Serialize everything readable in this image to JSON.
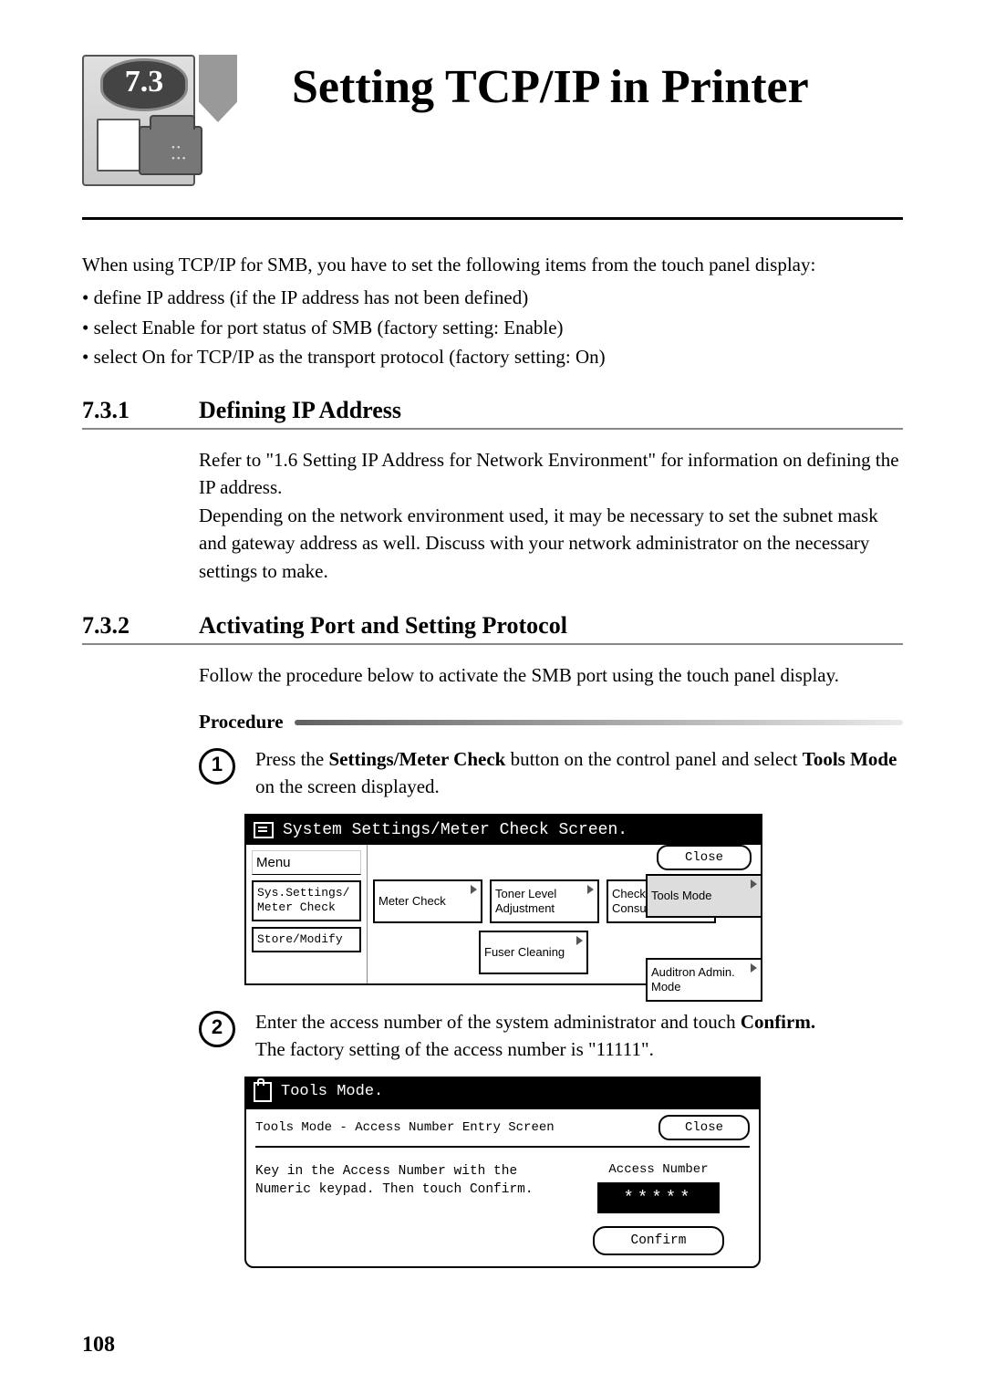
{
  "chapter": {
    "number": "7.3",
    "title": "Setting TCP/IP in Printer"
  },
  "intro": "When using TCP/IP for SMB, you have to set the following items from the touch panel display:",
  "bullets": [
    "• define IP address (if the IP address has not been defined)",
    "• select Enable for port status of SMB (factory setting: Enable)",
    "• select On for TCP/IP as the transport protocol (factory setting: On)"
  ],
  "sections": {
    "s731": {
      "num": "7.3.1",
      "title": "Defining IP Address",
      "body": "Refer to \"1.6 Setting IP Address for Network Environment\" for information on defining the IP address.\nDepending on the network environment used, it may be necessary to set the subnet mask and gateway address as well. Discuss with your network administrator on the necessary settings to make."
    },
    "s732": {
      "num": "7.3.2",
      "title": "Activating Port and Setting Protocol",
      "lead": "Follow the procedure below to activate the SMB port using the touch panel display.",
      "procedure_label": "Procedure",
      "steps": {
        "1": {
          "pre": "Press the ",
          "bold1": "Settings/Meter Check",
          "mid": " button on the control panel and select ",
          "bold2": "Tools Mode",
          "post": " on the screen displayed."
        },
        "2": {
          "pre": "Enter the access number of the system administrator and touch ",
          "bold1": "Confirm.",
          "post2": "The factory setting of the access number is \"11111\"."
        }
      }
    }
  },
  "panel1": {
    "title": "System Settings/Meter Check Screen.",
    "menu_label": "Menu",
    "close": "Close",
    "sys_settings": "Sys.Settings/\nMeter Check",
    "store_modify": "Store/Modify",
    "meter_check": "Meter Check",
    "toner": "Toner Level Adjustment",
    "check_consumables": "Check Consumables",
    "fuser": "Fuser Cleaning",
    "tools_mode": "Tools Mode",
    "auditron": "Auditron Admin. Mode"
  },
  "panel2": {
    "title": "Tools Mode.",
    "tab_label": "Tools Mode - Access Number Entry Screen",
    "close": "Close",
    "instruction": "Key in the Access Number with the Numeric keypad. Then touch Confirm.",
    "access_label": "Access Number",
    "access_value": "*****",
    "confirm": "Confirm"
  },
  "page_number": "108"
}
